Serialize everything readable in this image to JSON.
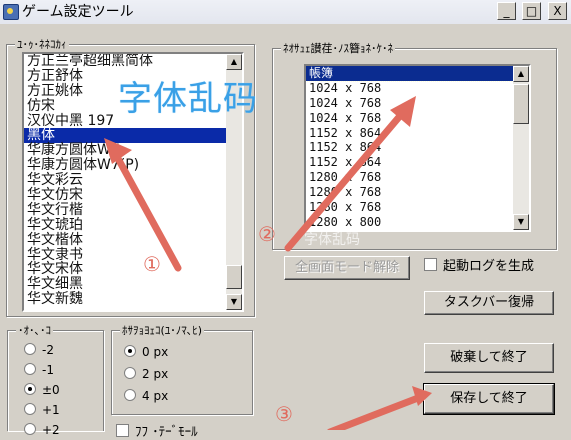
{
  "window": {
    "title": "ゲーム設定ツール",
    "minimize_glyph": "_",
    "maximize_glyph": "□",
    "close_glyph": "X"
  },
  "font_group": {
    "label": "ﾕ･ｩ･ﾈﾈｺｶｨ",
    "items": [
      "方正兰亭超细黑简体",
      "方正舒体",
      "方正姚体",
      "仿宋",
      "汉仪中黑 197",
      "黑体",
      "华康方圆体W7",
      "华康方圆体W7(P)",
      "华文彩云",
      "华文仿宋",
      "华文行楷",
      "华文琥珀",
      "华文楷体",
      "华文隶书",
      "华文宋体",
      "华文细黑",
      "华文新魏"
    ],
    "selected_index": 5
  },
  "resolution_group": {
    "label": "ﾈｵｻｭｪ讃荏･ﾉｽ簪ｮﾈ･ｹ･ﾈ",
    "items": [
      "帳簿",
      "1024 x 768",
      "1024 x 768",
      "1024 x 768",
      "1152 x 864",
      "1152 x 864",
      "1152 x 864",
      "1280 x 768",
      "1280 x 768",
      "1280 x 768",
      "1280 x 800"
    ],
    "selected_index": 0
  },
  "buttons": {
    "fullscreen_release": "全画面モード解除",
    "taskbar_restore": "タスクバー復帰",
    "discard_exit": "破棄して終了",
    "save_exit": "保存して終了"
  },
  "startup_log": {
    "label": "起動ログを生成",
    "checked": false
  },
  "pitch_group": {
    "label": "･ｵ･､･ｺ",
    "options": [
      "-2",
      "-1",
      "±0",
      "+1",
      "+2"
    ],
    "selected_index": 2
  },
  "offset_group": {
    "label": "ﾎｻｦｮﾖｪｺ(ﾕ･ﾉﾏ､ﾋ)",
    "options": [
      "0 px",
      "2 px",
      "4 px"
    ],
    "selected_index": 0
  },
  "bottom_check": {
    "label": "ﾌﾌ ･ﾃｰﾞﾓｰﾙ"
  },
  "annotations": {
    "garbled_text": "字体乱码",
    "step1": "①",
    "step2": "②",
    "step3": "③",
    "arrow_color": "#e06b5e",
    "watermark": "字体乱码"
  }
}
